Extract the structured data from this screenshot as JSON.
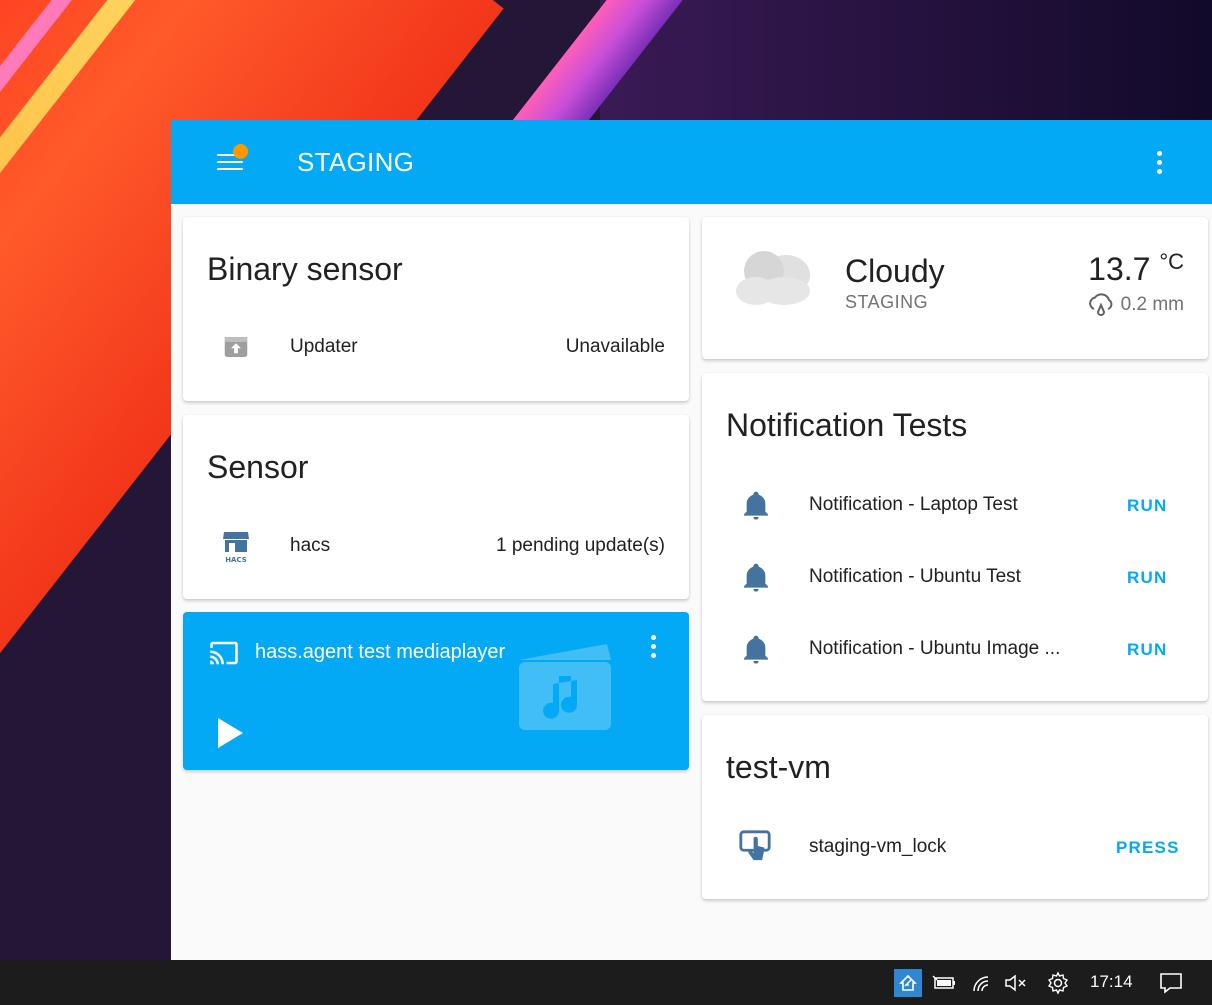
{
  "header": {
    "title": "STAGING"
  },
  "binary_sensor_card": {
    "title": "Binary sensor",
    "rows": [
      {
        "label": "Updater",
        "state": "Unavailable",
        "icon": "package-up-icon"
      }
    ]
  },
  "sensor_card": {
    "title": "Sensor",
    "rows": [
      {
        "label": "hacs",
        "state": "1 pending update(s)",
        "icon": "hacs-icon"
      }
    ]
  },
  "media_card": {
    "title": "hass.agent test mediaplayer",
    "icon": "cast-icon",
    "artwork_icon": "movie-music-icon",
    "play_icon": "play-icon"
  },
  "weather_card": {
    "condition": "Cloudy",
    "location": "STAGING",
    "temperature": "13.7",
    "unit": "°C",
    "precipitation": "0.2 mm",
    "icon": "cloud-icon"
  },
  "notification_card": {
    "title": "Notification Tests",
    "rows": [
      {
        "label": "Notification - Laptop Test",
        "action": "RUN",
        "icon": "bell-icon"
      },
      {
        "label": "Notification - Ubuntu Test",
        "action": "RUN",
        "icon": "bell-icon"
      },
      {
        "label": "Notification - Ubuntu Image ...",
        "action": "RUN",
        "icon": "bell-icon"
      }
    ]
  },
  "vm_card": {
    "title": "test-vm",
    "rows": [
      {
        "label": "staging-vm_lock",
        "action": "PRESS",
        "icon": "gesture-tap-icon"
      }
    ]
  },
  "taskbar": {
    "time": "17:14"
  },
  "colors": {
    "accent": "#03a9f4",
    "badge": "#ff9800",
    "icon_gray": "#44739e"
  }
}
